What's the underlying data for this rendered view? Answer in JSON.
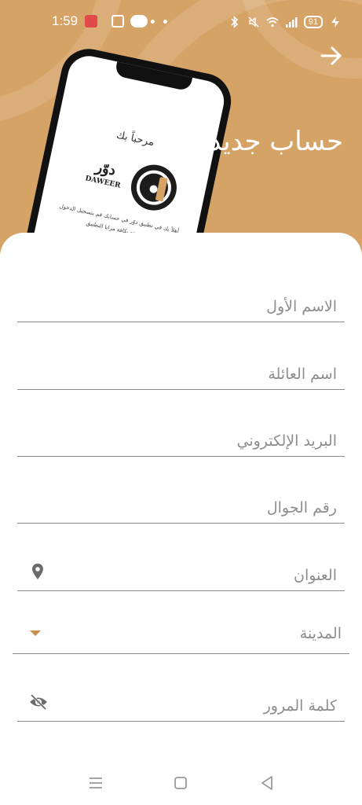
{
  "status_bar": {
    "time": "1:59",
    "battery": "91",
    "icons": [
      "music-icon",
      "news-icon",
      "chat-icon",
      "bluetooth-icon",
      "mute-icon",
      "wifi-icon",
      "signal-icon",
      "charging-icon"
    ]
  },
  "header": {
    "title": "حساب جديد",
    "back_icon": "arrow-right-icon",
    "background_color": "#d6a367"
  },
  "phone_mockup": {
    "welcome": "مرحباً بك",
    "brand_ar": "دوّر",
    "brand_en": "DAWEER",
    "body_line1": "أهلاً بك في تطبيق دوّر في حسابك قم بتسجيل الدخول",
    "body_line2": "لتستمتع بكافة مزايا التطبيق"
  },
  "form": {
    "first_name": {
      "placeholder": "الاسم الأول",
      "value": ""
    },
    "last_name": {
      "placeholder": "اسم العائلة",
      "value": ""
    },
    "email": {
      "placeholder": "البريد الإلكتروني",
      "value": ""
    },
    "phone": {
      "placeholder": "رقم الجوال",
      "value": ""
    },
    "address": {
      "placeholder": "العنوان",
      "value": "",
      "icon": "location-pin-icon"
    },
    "city": {
      "placeholder": "المدينة",
      "value": "",
      "icon": "dropdown-caret-icon"
    },
    "password": {
      "placeholder": "كلمة المرور",
      "value": "",
      "icon": "eye-off-icon"
    }
  },
  "colors": {
    "accent": "#d6a367",
    "caret": "#c98e4e",
    "placeholder": "#8d8d8d"
  },
  "nav_bar": {
    "icons": [
      "menu-icon",
      "home-icon",
      "back-icon"
    ]
  }
}
